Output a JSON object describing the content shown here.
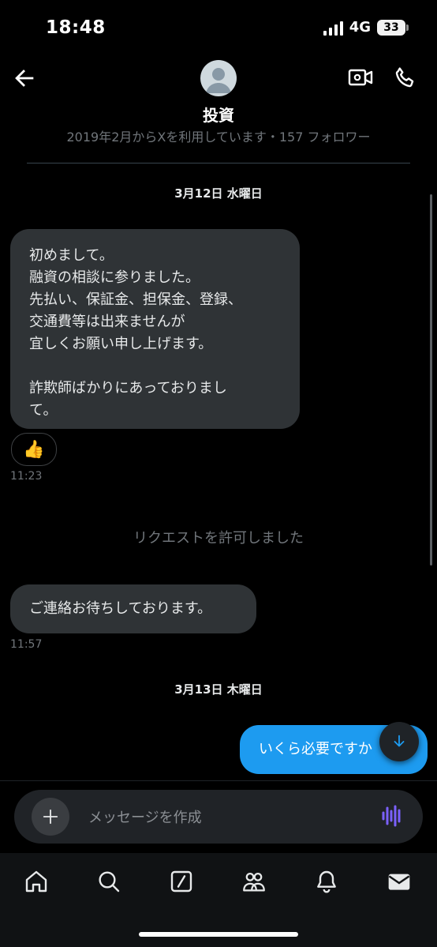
{
  "status": {
    "time": "18:48",
    "network": "4G",
    "battery": "33"
  },
  "header": {
    "title": "投資"
  },
  "profile_info": "2019年2月からXを利用しています・157 フォロワー",
  "colors": {
    "background": "#000000",
    "bubble_in": "#2f3336",
    "bubble_out": "#1d9bf0",
    "muted_text": "#71767b",
    "voice_accent": "#7b61ff"
  },
  "messages": {
    "date1": "3月12日 水曜日",
    "msg1": {
      "lines": [
        "初めまして。",
        "融資の相談に参りました。",
        "先払い、保証金、担保金、登録、",
        "交通費等は出来ませんが",
        "宜しくお願い申し上げます。",
        "",
        "詐欺師ばかりにあっておりまし",
        "て。"
      ],
      "reaction": "👍",
      "time": "11:23"
    },
    "system": "リクエストを許可しました",
    "msg2": {
      "text": "ご連絡お待ちしております。",
      "time": "11:57"
    },
    "date2": "3月13日 木曜日",
    "msg3": {
      "text": "いくら必要ですか"
    }
  },
  "composer": {
    "placeholder": "メッセージを作成"
  },
  "icons": {
    "back": "arrow-left-icon",
    "video": "video-call-icon",
    "phone": "phone-icon",
    "plus": "plus-icon",
    "voice": "voice-wave-icon",
    "scroll": "arrow-down-icon",
    "tabs": [
      "home-icon",
      "search-icon",
      "grok-icon",
      "communities-icon",
      "notifications-icon",
      "messages-icon"
    ]
  }
}
